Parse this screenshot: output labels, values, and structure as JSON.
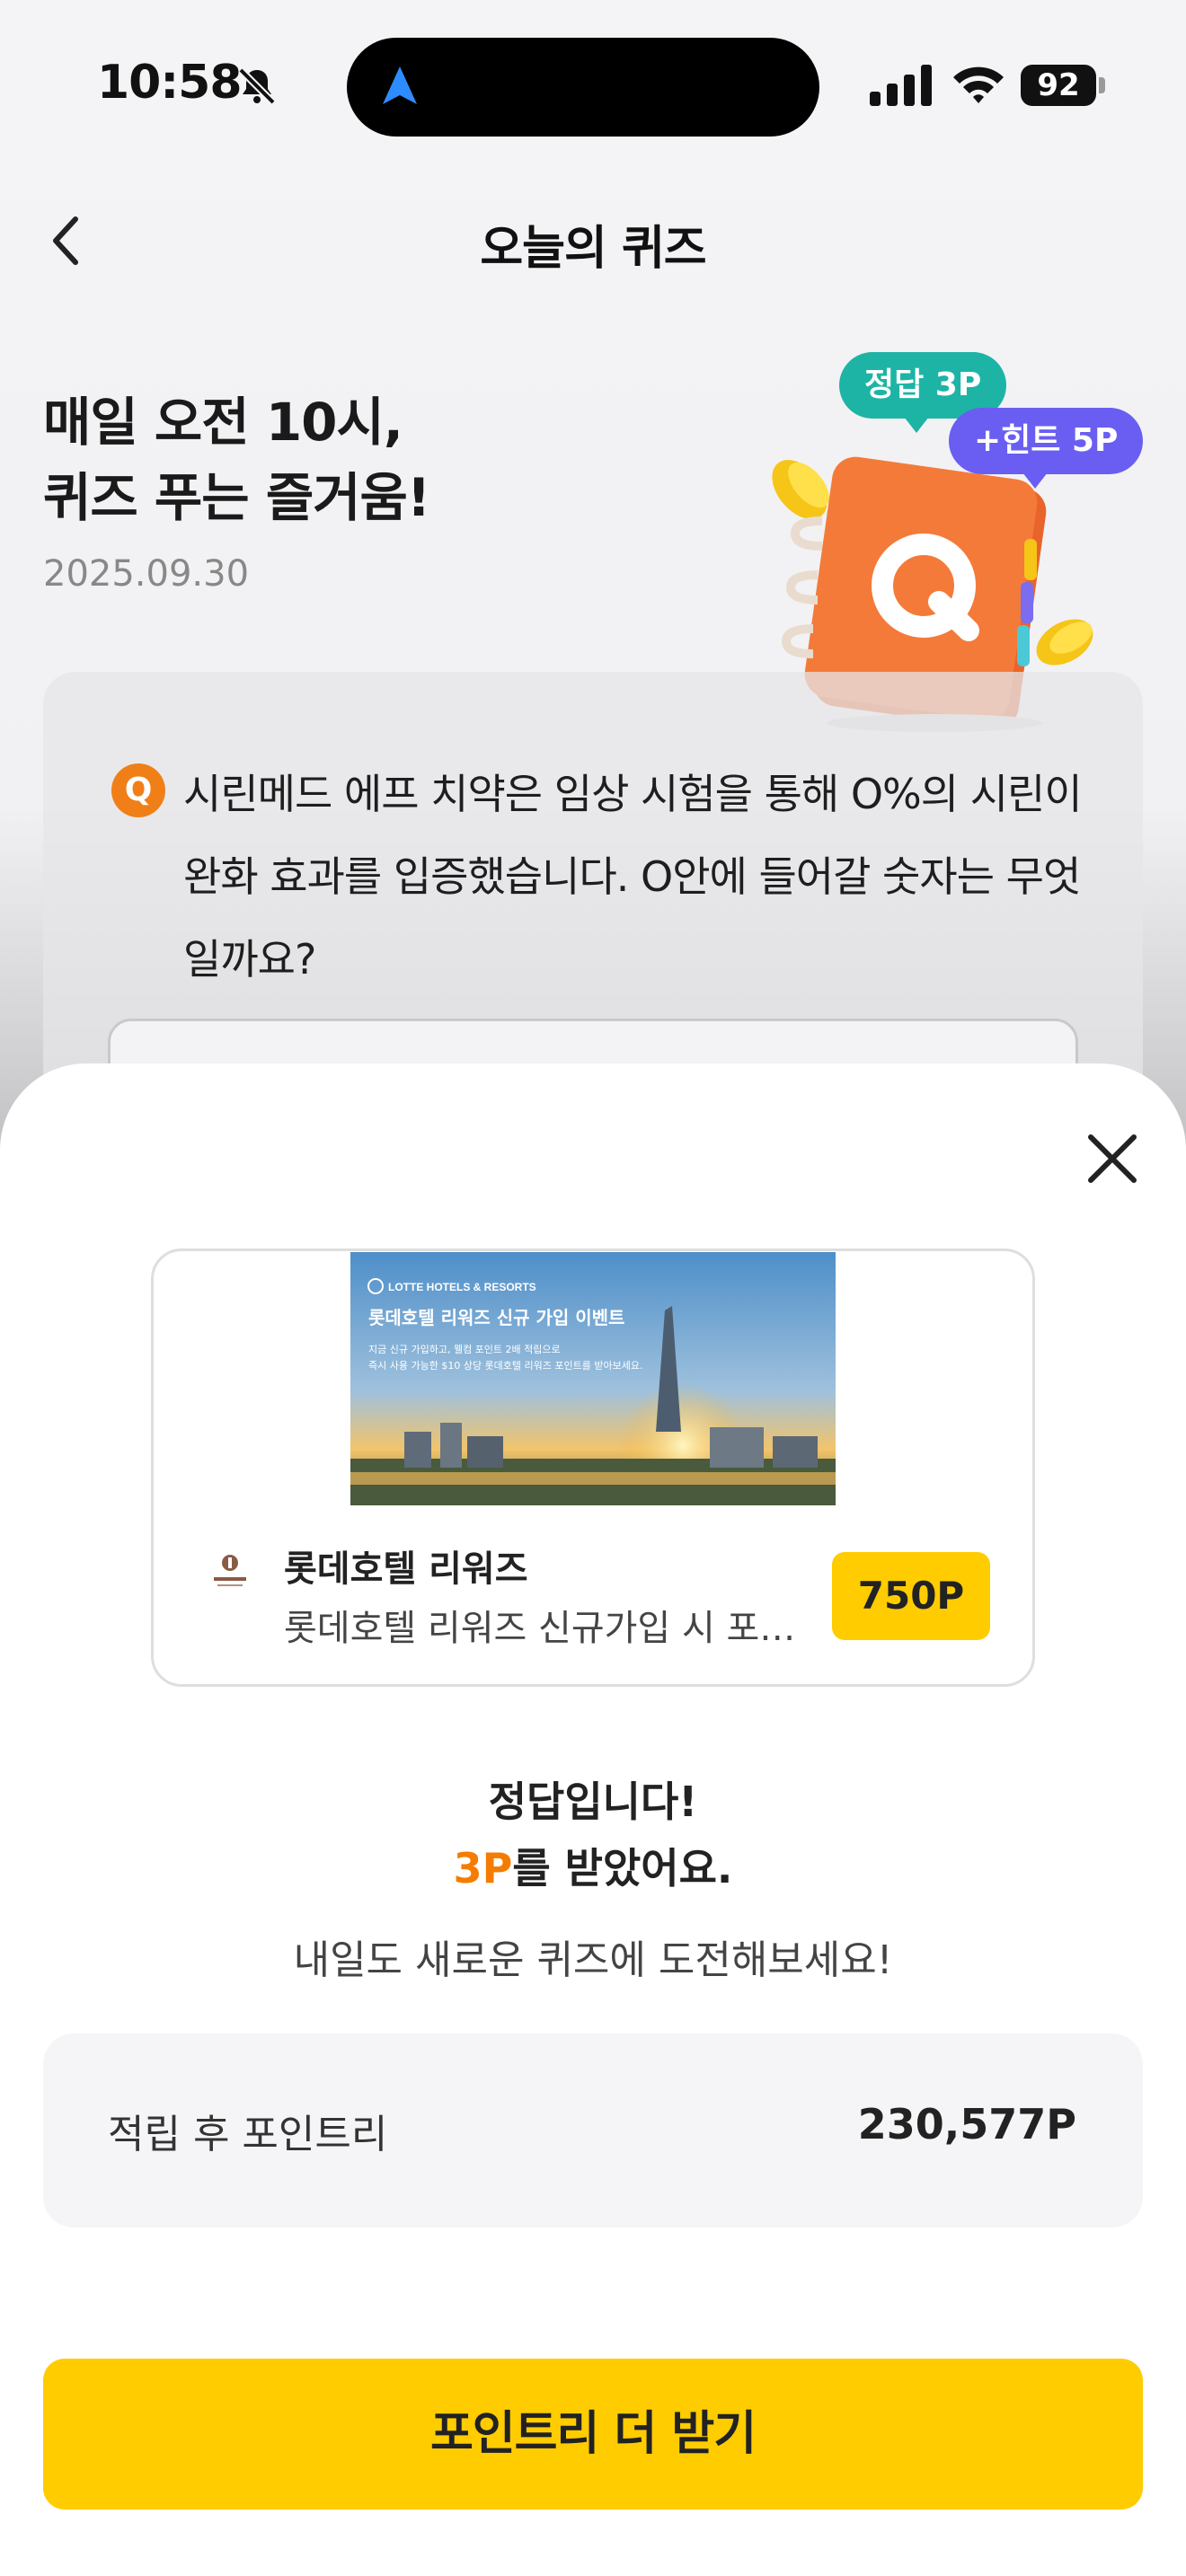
{
  "status_bar": {
    "time": "10:58",
    "battery": "92"
  },
  "header": {
    "title": "오늘의 퀴즈"
  },
  "hero": {
    "line1": "매일 오전 10시,",
    "line2": "퀴즈 푸는 즐거움!",
    "date": "2025.09.30"
  },
  "badges": {
    "correct": "정답 3P",
    "hint": "+힌트 5P"
  },
  "quiz": {
    "q_mark": "Q",
    "question": "시린메드 에프 치약은 임상 시험을 통해 O%의 시린이 완화 효과를 입증했습니다. O안에 들어갈 숫자는 무엇일까요?"
  },
  "ad": {
    "banner_brand": "LOTTE HOTELS & RESORTS",
    "banner_title": "롯데호텔 리워즈 신규 가입 이벤트",
    "banner_line1": "지금 신규 가입하고, 웰컴 포인트 2배 적립으로",
    "banner_line2": "즉시 사용 가능한 $10 상당 롯데호텔 리워즈 포인트를 받아보세요.",
    "name": "롯데호텔 리워즈",
    "description": "롯데호텔 리워즈 신규가입 시 포인트 적립",
    "points": "750P"
  },
  "result": {
    "line1": "정답입니다!",
    "points": "3P",
    "line2_suffix": "를 받았어요.",
    "line3": "내일도 새로운 퀴즈에 도전해보세요!"
  },
  "summary": {
    "label": "적립 후 포인트리",
    "value": "230,577P"
  },
  "cta": {
    "label": "포인트리 더 받기"
  },
  "colors": {
    "accent_yellow": "#ffcc00",
    "points_orange": "#f57c00",
    "badge_teal": "#1db4a6",
    "badge_purple": "#6a5ef2"
  }
}
